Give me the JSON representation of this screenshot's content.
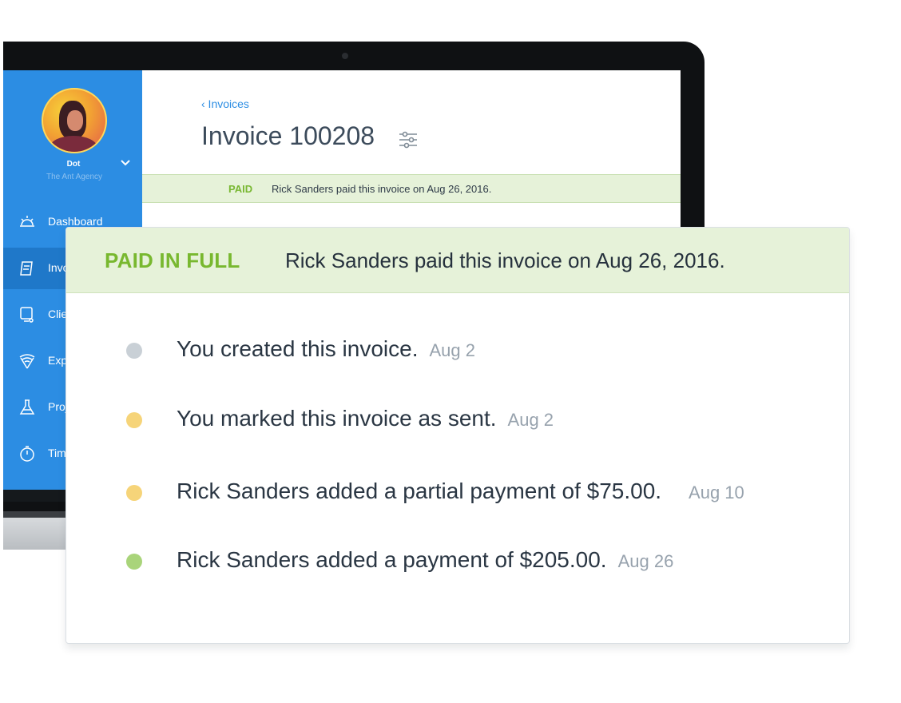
{
  "sidebar": {
    "account_name": "Dot",
    "account_org": "The Ant Agency",
    "items": [
      {
        "label": "Dashboard",
        "icon": "dashboard-icon"
      },
      {
        "label": "Invoices",
        "icon": "invoice-icon",
        "active": true
      },
      {
        "label": "Clients",
        "icon": "clients-icon"
      },
      {
        "label": "Expenses",
        "icon": "expenses-icon"
      },
      {
        "label": "Projects",
        "icon": "projects-icon"
      },
      {
        "label": "Time Tracking",
        "icon": "timer-icon"
      }
    ]
  },
  "invoice": {
    "back_label": "‹ Invoices",
    "title": "Invoice 100208",
    "status_tag": "PAID",
    "status_message": "Rick Sanders paid this invoice on Aug 26, 2016."
  },
  "card": {
    "status_tag": "PAID IN FULL",
    "status_message": "Rick Sanders paid this invoice on Aug 26, 2016.",
    "events": [
      {
        "text": "You created this invoice.",
        "date": "Aug 2",
        "dot_color": "#c9d0d6"
      },
      {
        "text": "You marked this invoice as sent.",
        "date": "Aug 2",
        "dot_color": "#f6d479"
      },
      {
        "text": "Rick Sanders added a partial payment of $75.00.",
        "date": "Aug 10",
        "dot_color": "#f6d479"
      },
      {
        "text": "Rick Sanders added a payment of $205.00.",
        "date": "Aug 26",
        "dot_color": "#a9d47a"
      }
    ]
  },
  "colors": {
    "brand_blue": "#2c8de3",
    "paid_green": "#78b82f",
    "paid_bg": "#e6f2d9"
  }
}
